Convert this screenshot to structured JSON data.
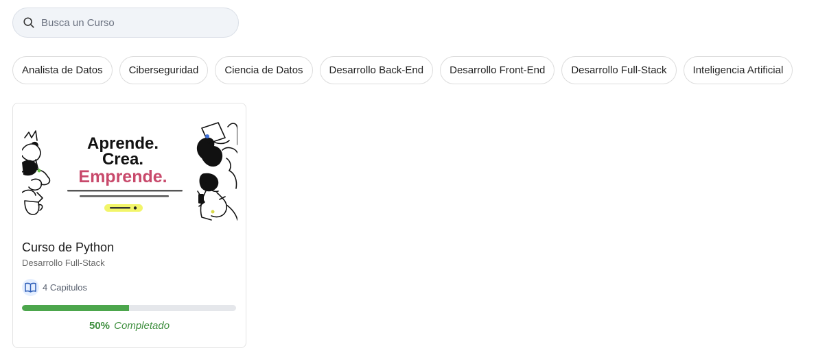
{
  "search": {
    "placeholder": "Busca un Curso",
    "value": "",
    "icon": "search-icon"
  },
  "categories": [
    {
      "label": "Analista de Datos"
    },
    {
      "label": "Ciberseguridad"
    },
    {
      "label": "Ciencia de Datos"
    },
    {
      "label": "Desarrollo Back-End"
    },
    {
      "label": "Desarrollo Front-End"
    },
    {
      "label": "Desarrollo Full-Stack"
    },
    {
      "label": "Inteligencia Artificial"
    }
  ],
  "courses": [
    {
      "thumbnail": {
        "line1": "Aprende.",
        "line2": "Crea.",
        "line3": "Emprende.",
        "accent_color": "#c8496b",
        "button_color": "#f2f56a"
      },
      "title": "Curso de Python",
      "category": "Desarrollo Full-Stack",
      "chapters_label": "4 Capitulos",
      "chapters_icon": "book-open-icon",
      "progress": 0.5,
      "progress_percent": "50%",
      "progress_word": "Completado"
    }
  ],
  "colors": {
    "progress_fill": "#4ca64c",
    "progress_track": "#e5e7eb",
    "progress_text": "#3f8f3f"
  }
}
